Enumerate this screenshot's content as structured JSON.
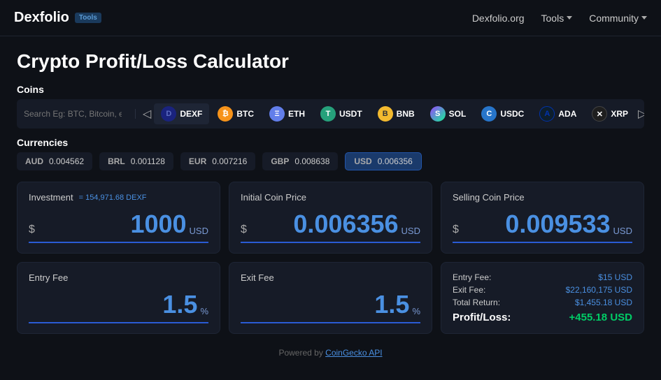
{
  "navbar": {
    "logo": "Dexfolio",
    "tools_badge": "Tools",
    "links": [
      {
        "id": "dexfolio-org",
        "label": "Dexfolio.org",
        "has_dropdown": false
      },
      {
        "id": "tools",
        "label": "Tools",
        "has_dropdown": true
      },
      {
        "id": "community",
        "label": "Community",
        "has_dropdown": true
      }
    ]
  },
  "page": {
    "title": "Crypto Profit/Loss Calculator"
  },
  "coins_section": {
    "label": "Coins",
    "search_placeholder": "Search Eg: BTC, Bitcoin, etc.",
    "coins": [
      {
        "id": "dexf",
        "symbol": "DEXF",
        "icon_class": "dexf",
        "icon_letter": "D",
        "active": true
      },
      {
        "id": "btc",
        "symbol": "BTC",
        "icon_class": "btc",
        "icon_letter": "₿",
        "active": false
      },
      {
        "id": "eth",
        "symbol": "ETH",
        "icon_class": "eth",
        "icon_letter": "Ξ",
        "active": false
      },
      {
        "id": "usdt",
        "symbol": "USDT",
        "icon_class": "usdt",
        "icon_letter": "T",
        "active": false
      },
      {
        "id": "bnb",
        "symbol": "BNB",
        "icon_class": "bnb",
        "icon_letter": "B",
        "active": false
      },
      {
        "id": "sol",
        "symbol": "SOL",
        "icon_class": "sol",
        "icon_letter": "S",
        "active": false
      },
      {
        "id": "usdc",
        "symbol": "USDC",
        "icon_class": "usdc",
        "icon_letter": "C",
        "active": false
      },
      {
        "id": "ada",
        "symbol": "ADA",
        "icon_class": "ada",
        "icon_letter": "A",
        "active": false
      },
      {
        "id": "xrp",
        "symbol": "XRP",
        "icon_class": "xrp",
        "icon_letter": "✕",
        "active": false
      }
    ]
  },
  "currencies_section": {
    "label": "Currencies",
    "currencies": [
      {
        "id": "aud",
        "code": "AUD",
        "value": "0.004562",
        "active": false
      },
      {
        "id": "brl",
        "code": "BRL",
        "value": "0.001128",
        "active": false
      },
      {
        "id": "eur",
        "code": "EUR",
        "value": "0.007216",
        "active": false
      },
      {
        "id": "gbp",
        "code": "GBP",
        "value": "0.008638",
        "active": false
      },
      {
        "id": "usd",
        "code": "USD",
        "value": "0.006356",
        "active": true
      }
    ]
  },
  "calculator": {
    "investment": {
      "title": "Investment",
      "subtitle": "= 154,971.68 DEXF",
      "currency_symbol": "$",
      "value": "1000",
      "unit": "USD"
    },
    "initial_coin_price": {
      "title": "Initial Coin Price",
      "currency_symbol": "$",
      "value": "0.006356",
      "unit": "USD"
    },
    "selling_coin_price": {
      "title": "Selling Coin Price",
      "currency_symbol": "$",
      "value": "0.009533",
      "unit": "USD"
    },
    "entry_fee": {
      "title": "Entry Fee",
      "value": "1.5",
      "unit": "%"
    },
    "exit_fee": {
      "title": "Exit Fee",
      "value": "1.5",
      "unit": "%"
    },
    "results": {
      "entry_fee_label": "Entry Fee:",
      "entry_fee_value": "$15 USD",
      "exit_fee_label": "Exit Fee:",
      "exit_fee_value": "$22,160,175 USD",
      "total_return_label": "Total Return:",
      "total_return_value": "$1,455.18 USD",
      "profit_loss_label": "Profit/Loss:",
      "profit_loss_value": "+455.18 USD"
    }
  },
  "footer": {
    "text": "Powered by ",
    "link_text": "CoinGecko API"
  }
}
